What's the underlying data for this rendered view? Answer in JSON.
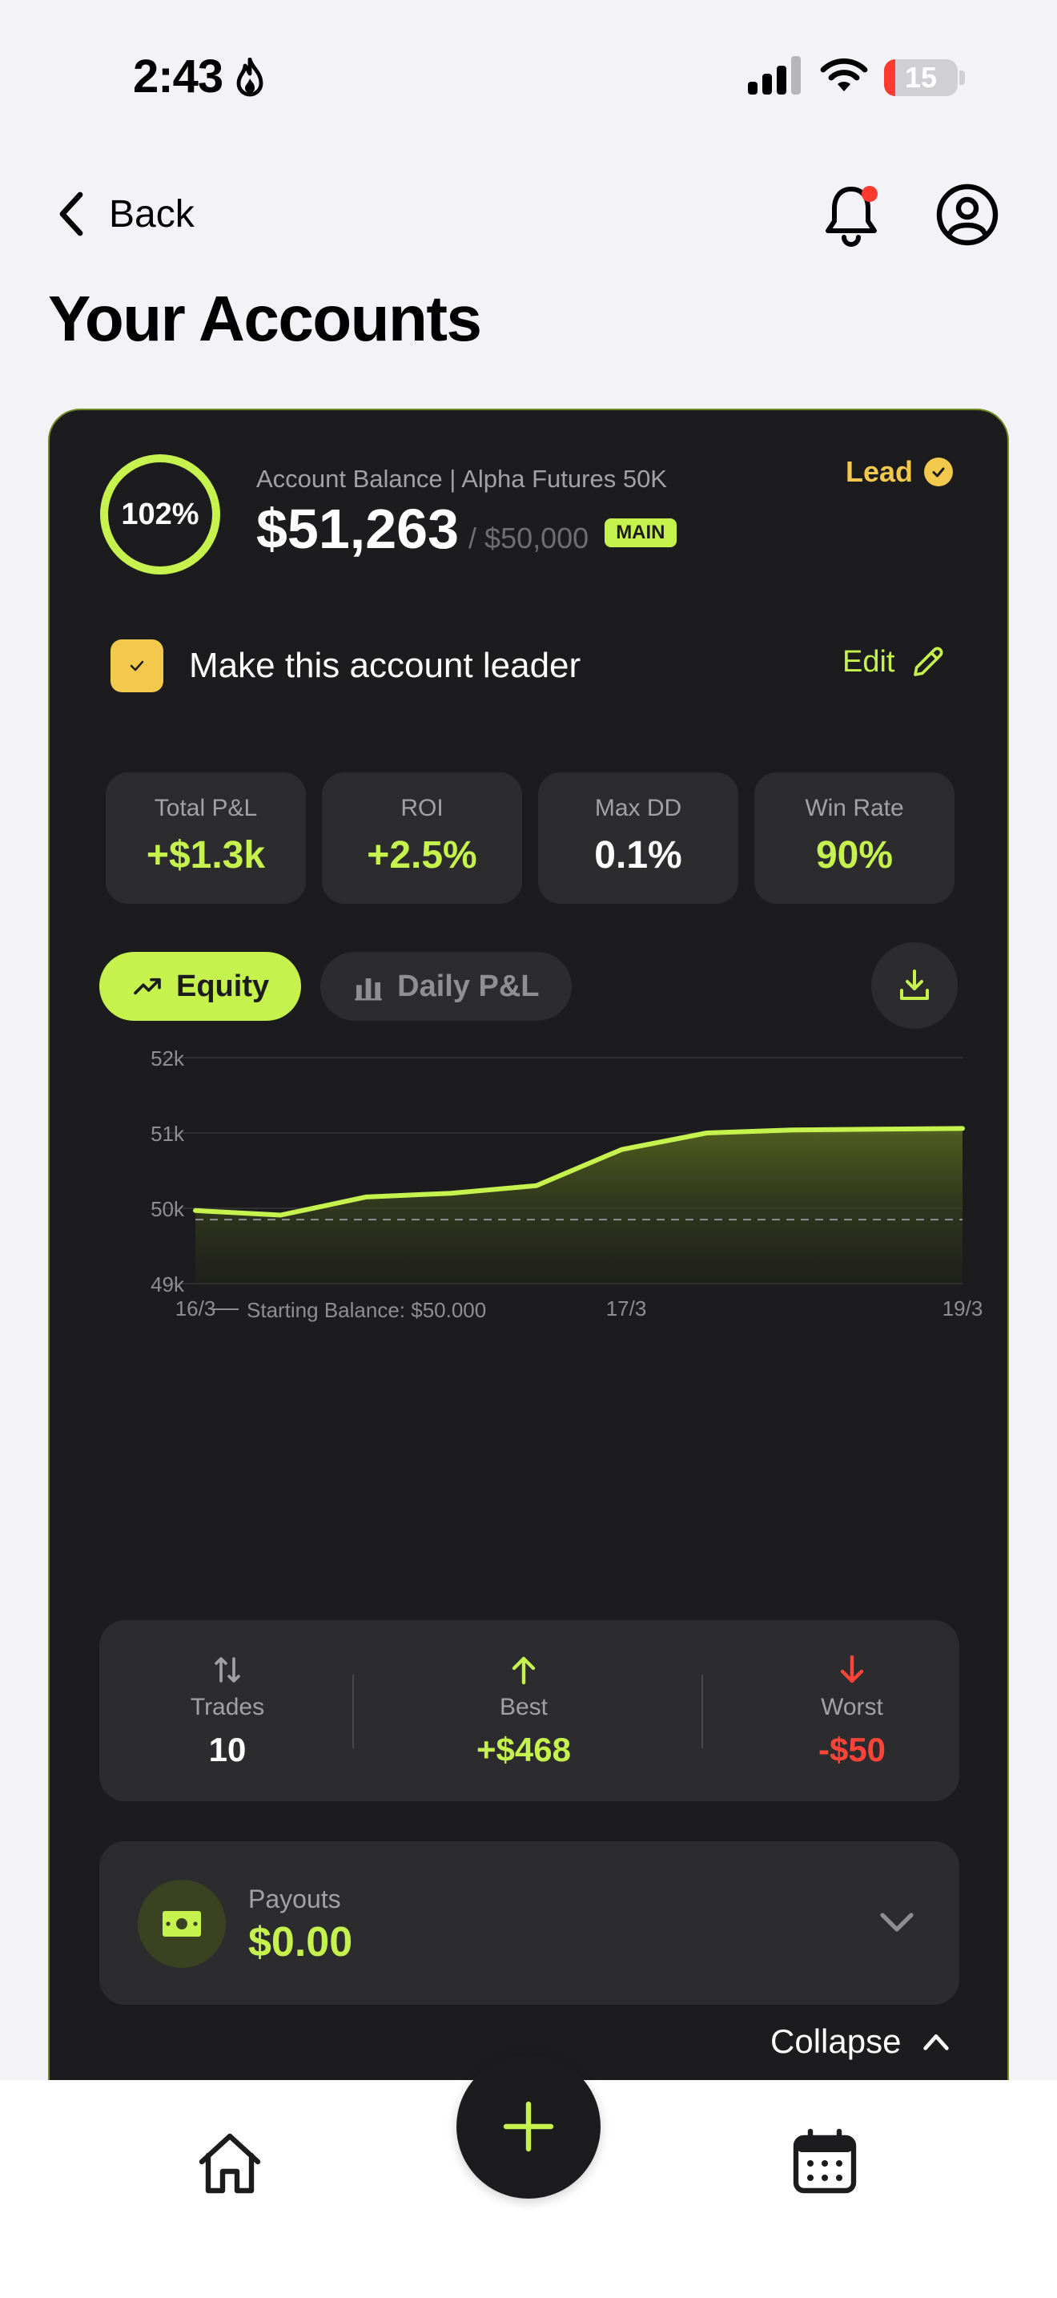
{
  "status_bar": {
    "time": "2:43",
    "battery": "15",
    "battery_level": 0.15
  },
  "nav": {
    "back_label": "Back"
  },
  "page_title": "Your Accounts",
  "account": {
    "progress_label": "102%",
    "progress_value": 1.02,
    "balance_label": "Account Balance | Alpha Futures 50K",
    "balance": "$51,263",
    "balance_of": "/ $50,000",
    "badge": "MAIN",
    "lead_label": "Lead",
    "leader_checkbox_label": "Make this account leader",
    "leader_checked": true,
    "edit_label": "Edit"
  },
  "stats": [
    {
      "label": "Total P&L",
      "value": "+$1.3k",
      "color": "#c6f24e"
    },
    {
      "label": "ROI",
      "value": "+2.5%",
      "color": "#c6f24e"
    },
    {
      "label": "Max DD",
      "value": "0.1%",
      "color": "#ffffff"
    },
    {
      "label": "Win Rate",
      "value": "90%",
      "color": "#c6f24e"
    }
  ],
  "tabs": {
    "equity": "Equity",
    "daily": "Daily P&L",
    "active": "equity"
  },
  "chart_data": {
    "type": "area",
    "y_ticks": [
      "52k",
      "51k",
      "50k",
      "49k"
    ],
    "ylim": [
      49000,
      52000
    ],
    "x_ticks": [
      "16/3",
      "17/3",
      "19/3"
    ],
    "series": [
      {
        "values": [
          49970,
          49910,
          50150,
          50200,
          50300,
          50780,
          51000,
          51040,
          51050,
          51060
        ]
      }
    ],
    "baseline": {
      "value": 49850,
      "label": "Starting Balance: $50.000"
    },
    "grid": true,
    "colors": {
      "line": "#c6f24e",
      "fill": "#5a6b1f"
    }
  },
  "trade_summary": {
    "trades": {
      "label": "Trades",
      "value": "10"
    },
    "best": {
      "label": "Best",
      "value": "+$468"
    },
    "worst": {
      "label": "Worst",
      "value": "-$50"
    }
  },
  "payouts": {
    "label": "Payouts",
    "value": "$0.00"
  },
  "collapse_label": "Collapse",
  "colors": {
    "accent": "#c6f24e",
    "lead": "#f2c94c",
    "negative": "#ff453a",
    "card": "#1c1c1e"
  }
}
